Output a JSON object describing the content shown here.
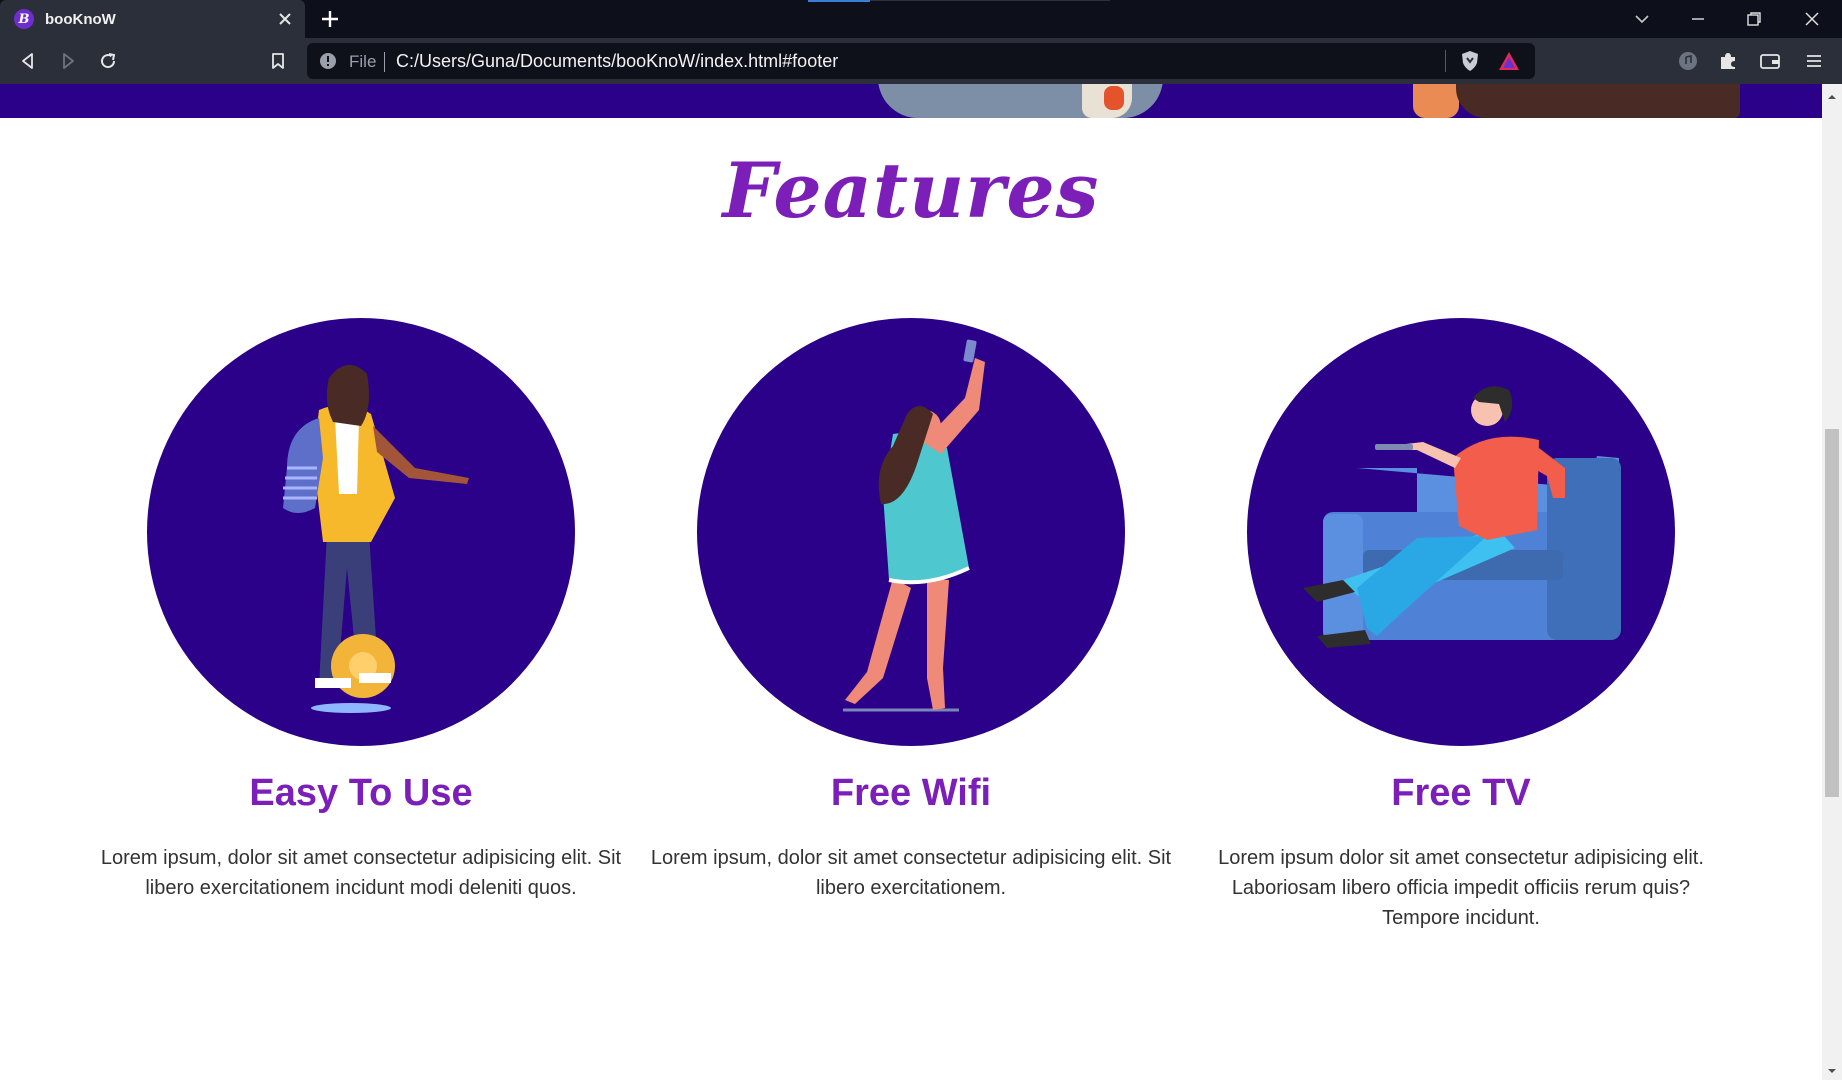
{
  "browser": {
    "tab_title": "booKnoW",
    "favicon_letter": "B",
    "url_scheme": "File",
    "url": "C:/Users/Guna/Documents/booKnoW/index.html#footer"
  },
  "page": {
    "section_title": "Features",
    "features": [
      {
        "title": "Easy To Use",
        "description": "Lorem ipsum, dolor sit amet consectetur adipisicing elit. Sit libero exercitationem incidunt modi deleniti quos."
      },
      {
        "title": "Free Wifi",
        "description": "Lorem ipsum, dolor sit amet consectetur adipisicing elit. Sit libero exercitationem."
      },
      {
        "title": "Free TV",
        "description": "Lorem ipsum dolor sit amet consectetur adipisicing elit. Laboriosam libero officia impedit officiis rerum quis? Tempore incidunt."
      }
    ]
  },
  "colors": {
    "brand_purple": "#7c1fb8",
    "circle_navy": "#2a0188",
    "chrome_dark": "#0d0f1a",
    "chrome_toolbar": "#2b2f3a"
  }
}
